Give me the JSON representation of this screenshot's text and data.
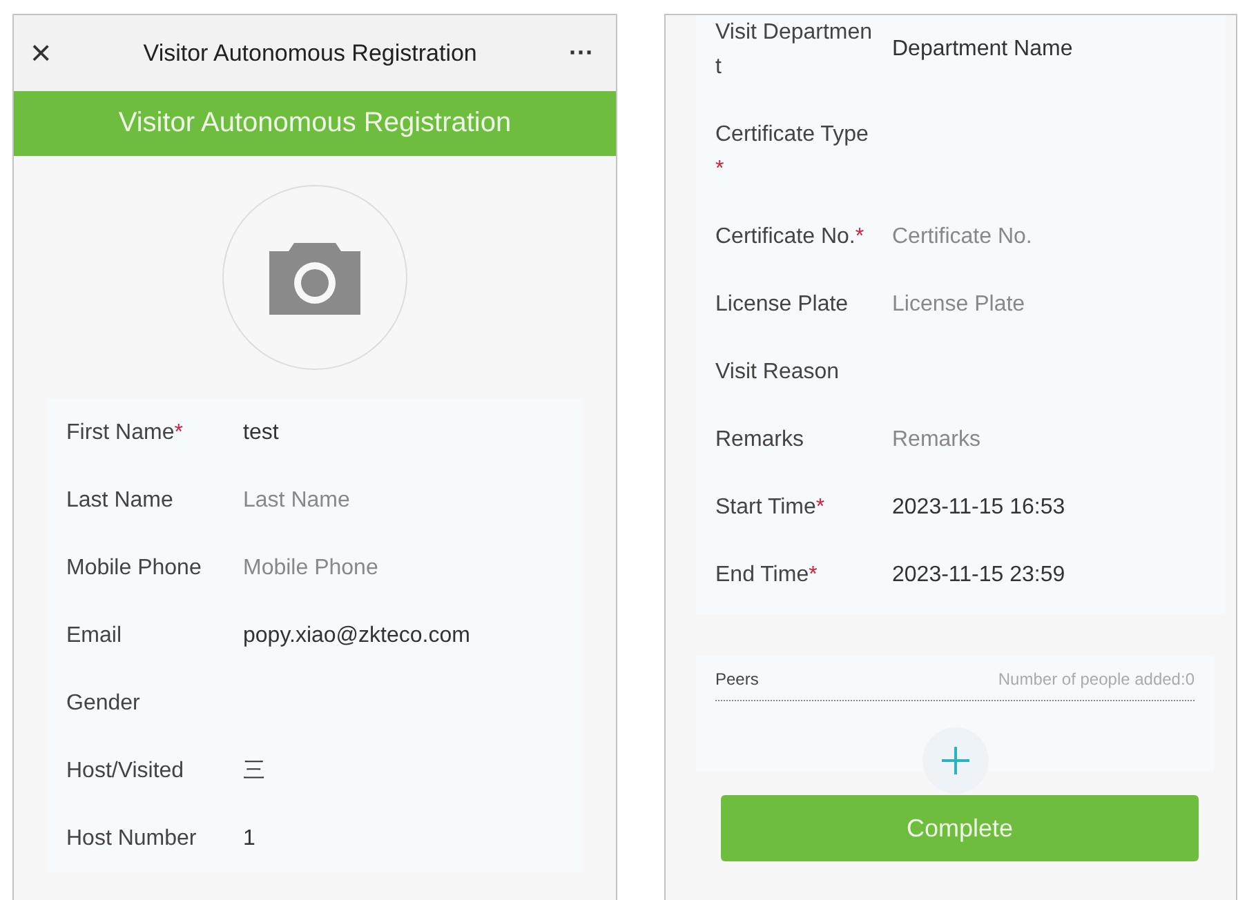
{
  "left_screen": {
    "title_bar": {
      "close": "×",
      "title": "Visitor Autonomous Registration",
      "more": "···"
    },
    "banner": "Visitor Autonomous Registration",
    "fields": [
      {
        "label": "First Name",
        "required_mark": "*",
        "value": "test"
      },
      {
        "label": "Last Name",
        "placeholder": "Last Name"
      },
      {
        "label": "Mobile Phone",
        "placeholder": "Mobile Phone"
      },
      {
        "label": "Email",
        "value": "popy.xiao@zkteco.com"
      },
      {
        "label": "Gender"
      },
      {
        "label": "Host/Visited",
        "value": "三"
      },
      {
        "label": "Host Number",
        "value": "1"
      }
    ]
  },
  "right_screen": {
    "fields": [
      {
        "label": "Visit Department",
        "value": "Department Name"
      },
      {
        "label": "Certificate Type",
        "required_mark": "*"
      },
      {
        "label": "Certificate No.",
        "required_mark": "*",
        "placeholder": "Certificate No."
      },
      {
        "label": "License Plate",
        "placeholder": "License Plate"
      },
      {
        "label": "Visit Reason"
      },
      {
        "label": "Remarks",
        "placeholder": "Remarks"
      },
      {
        "label": "Start Time",
        "required_mark": "*",
        "value": "2023-11-15 16:53"
      },
      {
        "label": "End Time",
        "required_mark": "*",
        "value": "2023-11-15 23:59"
      }
    ],
    "peers": {
      "label": "Peers",
      "count": "Number of people added:0"
    },
    "button": "Complete"
  }
}
